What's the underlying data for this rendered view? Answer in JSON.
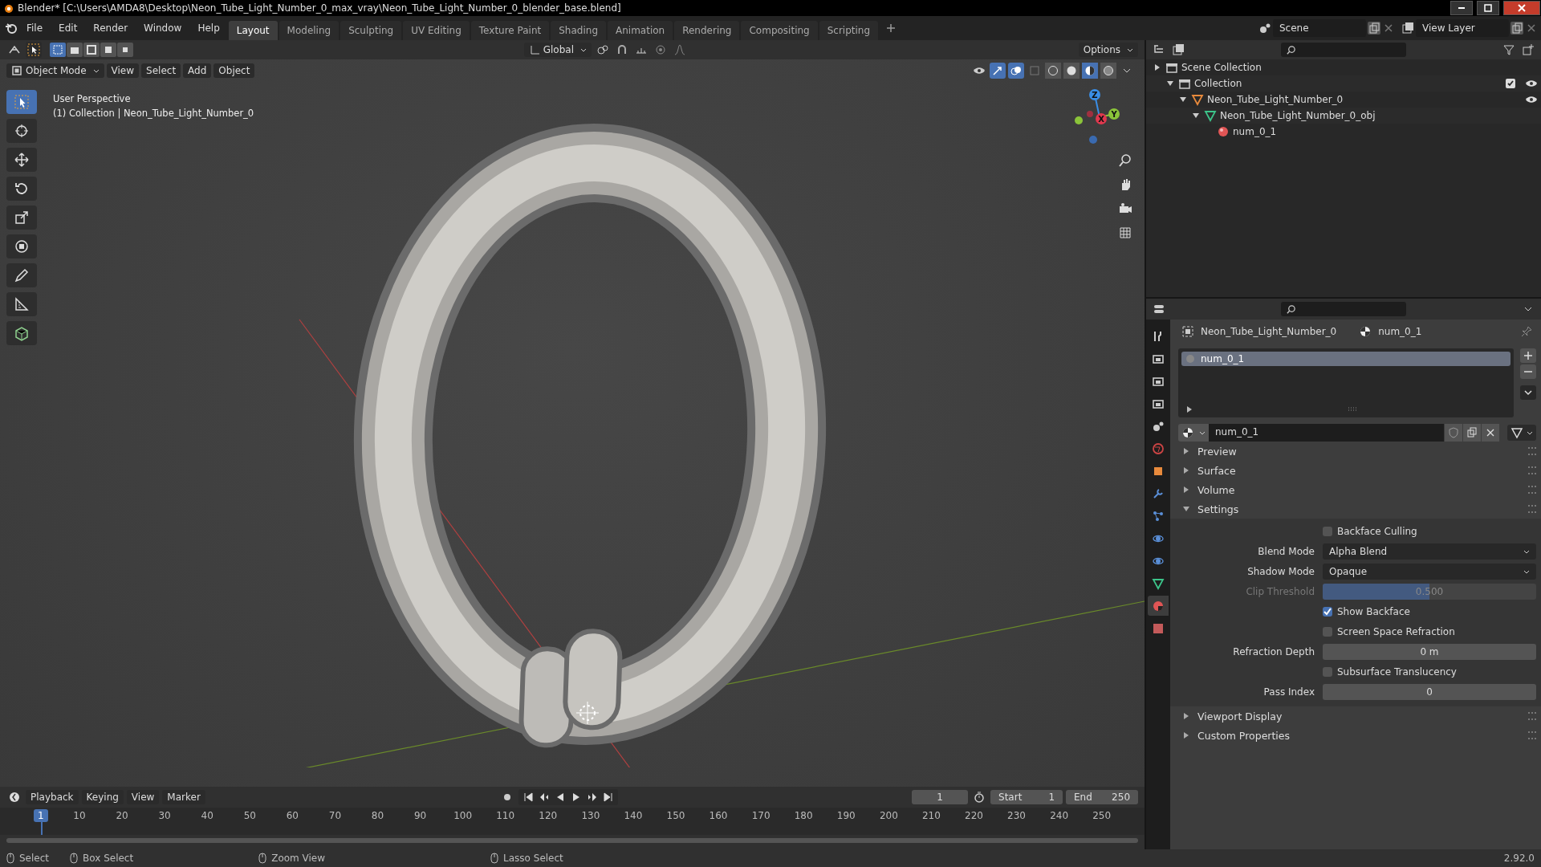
{
  "window": {
    "title": "Blender* [C:\\Users\\AMDA8\\Desktop\\Neon_Tube_Light_Number_0_max_vray\\Neon_Tube_Light_Number_0_blender_base.blend]"
  },
  "menu": [
    "File",
    "Edit",
    "Render",
    "Window",
    "Help"
  ],
  "workspaces": [
    {
      "label": "Layout",
      "selected": true
    },
    {
      "label": "Modeling",
      "selected": false
    },
    {
      "label": "Sculpting",
      "selected": false
    },
    {
      "label": "UV Editing",
      "selected": false
    },
    {
      "label": "Texture Paint",
      "selected": false
    },
    {
      "label": "Shading",
      "selected": false
    },
    {
      "label": "Animation",
      "selected": false
    },
    {
      "label": "Rendering",
      "selected": false
    },
    {
      "label": "Compositing",
      "selected": false
    },
    {
      "label": "Scripting",
      "selected": false
    }
  ],
  "scene": "Scene",
  "view_layer": "View Layer",
  "viewport": {
    "selection_modes": [
      {
        "kind": "new",
        "selected": true
      },
      {
        "kind": "extend",
        "selected": false
      },
      {
        "kind": "subtract",
        "selected": false
      },
      {
        "kind": "invert",
        "selected": false
      },
      {
        "kind": "intersect",
        "selected": false
      }
    ],
    "transform": "Global",
    "options": "Options",
    "mode": "Object Mode",
    "menus": [
      "View",
      "Select",
      "Add",
      "Object"
    ],
    "shading_modes": [
      {
        "kind": "wireframe",
        "selected": false
      },
      {
        "kind": "solid",
        "selected": false
      },
      {
        "kind": "material",
        "selected": true
      },
      {
        "kind": "rendered",
        "selected": false
      }
    ],
    "overlay_lines": [
      "User Perspective",
      "(1) Collection | Neon_Tube_Light_Number_0"
    ],
    "tools": [
      {
        "kind": "select",
        "selected": true
      },
      {
        "kind": "cursor",
        "selected": false
      },
      {
        "kind": "move",
        "selected": false
      },
      {
        "kind": "rotate",
        "selected": false
      },
      {
        "kind": "scale",
        "selected": false
      },
      {
        "kind": "transform",
        "selected": false
      },
      {
        "kind": "annotate",
        "selected": false
      },
      {
        "kind": "measure",
        "selected": false
      },
      {
        "kind": "add_cube",
        "selected": false
      }
    ],
    "gizmo_axes": [
      {
        "label": "Z",
        "kind": "z"
      },
      {
        "label": "Y",
        "kind": "y"
      },
      {
        "label": "X",
        "kind": "x"
      }
    ]
  },
  "outliner": {
    "items": [
      {
        "label": "Scene Collection",
        "kind": "scene",
        "children": [
          {
            "label": "Collection",
            "kind": "collection",
            "expanded": true,
            "checked": true,
            "children": [
              {
                "label": "Neon_Tube_Light_Number_0",
                "kind": "object",
                "expanded": true,
                "children": [
                  {
                    "label": "Neon_Tube_Light_Number_0_obj",
                    "kind": "mesh",
                    "expanded": true,
                    "children": [
                      {
                        "label": "num_0_1",
                        "kind": "material"
                      }
                    ]
                  }
                ]
              }
            ]
          }
        ]
      }
    ]
  },
  "properties": {
    "tabs": [
      {
        "kind": "tool",
        "selected": false
      },
      {
        "kind": "render",
        "selected": false
      },
      {
        "kind": "output",
        "selected": false
      },
      {
        "kind": "view_layer",
        "selected": false
      },
      {
        "kind": "scene",
        "selected": false
      },
      {
        "kind": "world",
        "selected": false
      },
      {
        "kind": "object",
        "selected": false
      },
      {
        "kind": "modifiers",
        "selected": false
      },
      {
        "kind": "particles",
        "selected": false
      },
      {
        "kind": "physics",
        "selected": false
      },
      {
        "kind": "constraints",
        "selected": false
      },
      {
        "kind": "data",
        "selected": false
      },
      {
        "kind": "material",
        "selected": true
      },
      {
        "kind": "texture",
        "selected": false
      }
    ],
    "breadcrumb": [
      "Neon_Tube_Light_Number_0",
      "num_0_1"
    ],
    "slots": [
      {
        "label": "num_0_1",
        "selected": true
      }
    ],
    "material_name": "num_0_1",
    "panels": [
      {
        "label": "Preview",
        "expanded": false
      },
      {
        "label": "Surface",
        "expanded": false
      },
      {
        "label": "Volume",
        "expanded": false
      },
      {
        "label": "Settings",
        "expanded": true
      }
    ],
    "settings": [
      {
        "kind": "checkbox",
        "label": "Backface Culling",
        "checked": false,
        "disabled": false
      },
      {
        "kind": "dropdown",
        "label": "Blend Mode",
        "value": "Alpha Blend",
        "disabled": false
      },
      {
        "kind": "dropdown",
        "label": "Shadow Mode",
        "value": "Opaque",
        "disabled": false
      },
      {
        "kind": "slider",
        "label": "Clip Threshold",
        "value": "0.500",
        "level": 0.5,
        "disabled": true
      },
      {
        "kind": "checkbox",
        "label": "Show Backface",
        "checked": true,
        "disabled": false
      },
      {
        "kind": "checkbox",
        "label": "Screen Space Refraction",
        "checked": false,
        "disabled": false
      },
      {
        "kind": "number",
        "label": "Refraction Depth",
        "value": "0 m",
        "disabled": false
      },
      {
        "kind": "checkbox",
        "label": "Subsurface Translucency",
        "checked": false,
        "disabled": false
      },
      {
        "kind": "number",
        "label": "Pass Index",
        "value": "0",
        "disabled": false
      }
    ],
    "panels_after": [
      {
        "label": "Viewport Display",
        "expanded": false
      },
      {
        "label": "Custom Properties",
        "expanded": false
      }
    ]
  },
  "timeline": {
    "menus": [
      "Playback",
      "Keying",
      "View",
      "Marker"
    ],
    "frame": "1",
    "start_label": "Start",
    "start": "1",
    "end_label": "End",
    "end": "250",
    "current_frame": "1",
    "ticks": [
      "10",
      "20",
      "30",
      "40",
      "50",
      "60",
      "70",
      "80",
      "90",
      "100",
      "110",
      "120",
      "130",
      "140",
      "150",
      "160",
      "170",
      "180",
      "190",
      "200",
      "210",
      "220",
      "230",
      "240",
      "250"
    ]
  },
  "status_bar": {
    "items": [
      "Select",
      "Box Select",
      "Zoom View",
      "Lasso Select"
    ],
    "version": "2.92.0"
  }
}
